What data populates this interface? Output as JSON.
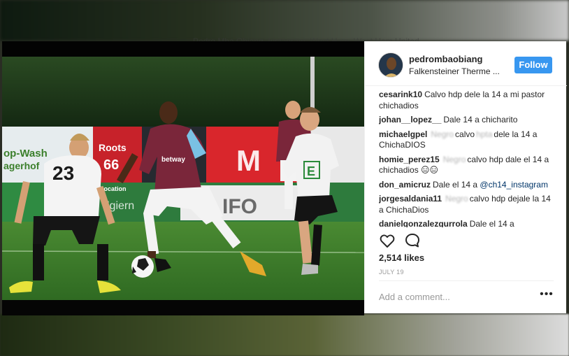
{
  "post": {
    "username": "pedrombaobiang",
    "location": "Falkensteiner Therme ...",
    "follow_label": "Follow",
    "likes": "2,514 likes",
    "date": "JULY 19",
    "comment_placeholder": "Add a comment...",
    "more_label": "•••"
  },
  "comments": [
    {
      "user": "cesarink10",
      "pre": "Calvo hdp dele la 14 a mi pastor chichadios",
      "blur": "",
      "post": "",
      "mention": ""
    },
    {
      "user": "johan__lopez__",
      "pre": "Dale 14 a chicharito",
      "blur": "",
      "post": "",
      "mention": ""
    },
    {
      "user": "michaelgpel",
      "pre": "",
      "blur": "Negro",
      "post": "calvo",
      "blur2": "hpta",
      "post2": "dele la 14 a ChichaDIOS"
    },
    {
      "user": "homie_perez15",
      "pre": "",
      "blur": "Negro",
      "post": "calvo hdp dale el 14 a chichadios 😑😑"
    },
    {
      "user": "don_amicruz",
      "pre": "Dale el 14 a",
      "mention": "@ch14_instagram"
    },
    {
      "user": "jorgesaldania11",
      "pre": "",
      "blur": "Negro",
      "post": "calvo hdp dejale la 14 a ChichaDios"
    },
    {
      "user": "danielgonzalezgurrola",
      "pre": "Dale el 14 a"
    }
  ],
  "photo": {
    "left_ad": "op-Wash",
    "left_ad2": "agerhof",
    "roots_ad": "Roots",
    "number_66": "66",
    "player_number": "23",
    "sponsor": "betway",
    "ifo": "IFO",
    "location_ad": "Location"
  },
  "colors": {
    "accent": "#3897f0",
    "claret": "#7a263a",
    "sky_blue": "#7ac1e4",
    "pitch": "#3f7a2c"
  },
  "icons": {
    "like": "heart-outline",
    "comment": "speech-bubble-outline"
  }
}
